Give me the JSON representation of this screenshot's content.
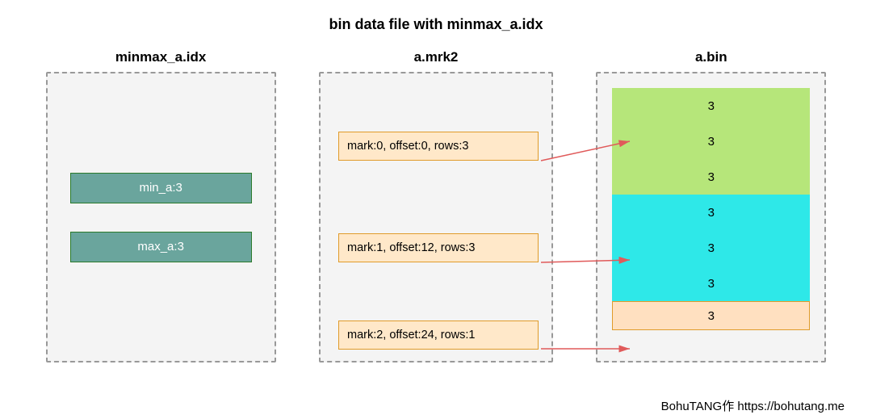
{
  "title": "bin data file with minmax_a.idx",
  "panels": {
    "idx": {
      "label": "minmax_a.idx",
      "rows": [
        {
          "key": "min_a",
          "value": 3,
          "text": "min_a:3"
        },
        {
          "key": "max_a",
          "value": 3,
          "text": "max_a:3"
        }
      ]
    },
    "mrk": {
      "label": "a.mrk2",
      "rows": [
        {
          "mark": 0,
          "offset": 0,
          "rows": 3,
          "text": "mark:0, offset:0,  rows:3"
        },
        {
          "mark": 1,
          "offset": 12,
          "rows": 3,
          "text": "mark:1, offset:12,  rows:3"
        },
        {
          "mark": 2,
          "offset": 24,
          "rows": 1,
          "text": "mark:2, offset:24,  rows:1"
        }
      ]
    },
    "bin": {
      "label": "a.bin",
      "groups": [
        {
          "color": "#b6e67a",
          "values": [
            3,
            3,
            3
          ]
        },
        {
          "color": "#2ee8e8",
          "values": [
            3,
            3,
            3
          ]
        },
        {
          "color": "#ffe0c0",
          "values": [
            3
          ]
        }
      ]
    }
  },
  "footer": "BohuTANG作 https://bohutang.me"
}
